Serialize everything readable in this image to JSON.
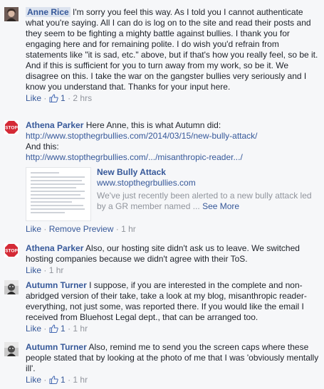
{
  "comments": [
    {
      "author": "Anne Rice",
      "text": "I'm sorry you feel this way. As I told you I cannot authenticate what you're saying. All I can do is log on to the site and read their posts and they seem to be fighting a mighty battle against bullies. I thank you for engaging here and for remaining polite. I do wish you'd refrain from statements like \"it is sad, etc.\" above, but if that's how you really feel, so be it. And if this is sufficient for you to turn away from my work, so be it. We disagree on this. I take the war on the gangster bullies very seriously and I know you understand that. Thanks for your input here.",
      "like": "Like",
      "likes": "1",
      "time": "2 hrs"
    },
    {
      "author": "Athena Parker",
      "text": "Here Anne, this is what Autumn did:",
      "link1": "http://www.stopthegrbullies.com/2014/03/15/new-bully-attack/",
      "and_this": "And this:",
      "link2": "http://www.stopthegrbullies.com/.../misanthropic-reader.../",
      "preview": {
        "title": "New Bully Attack",
        "domain": "www.stopthegrbullies.com",
        "desc": "We've just recently been alerted to a new bully attack led by a GR member named ...",
        "more": "See More"
      },
      "like": "Like",
      "remove": "Remove Preview",
      "time": "1 hr"
    },
    {
      "author": "Athena Parker",
      "text": "Also, our hosting site didn't ask us to leave. We switched hosting companies because we didn't agree with their ToS.",
      "like": "Like",
      "time": "1 hr"
    },
    {
      "author": "Autumn Turner",
      "text": "I suppose, if you are interested in the complete and non-abridged version of their take, take a look at my blog, misanthropic reader- everything, not just some, was reported there. If you would like the email I received from Bluehost Legal dept., that can be arranged too.",
      "like": "Like",
      "likes": "1",
      "time": "1 hr"
    },
    {
      "author": "Autumn Turner",
      "text": "Also, remind me to send you the screen caps where these people stated that by looking at the photo of me that I was 'obviously mentally ill'.",
      "like": "Like",
      "likes": "1",
      "time": "1 hr"
    }
  ],
  "dot": "·",
  "avatar_stop_text": "STOP"
}
